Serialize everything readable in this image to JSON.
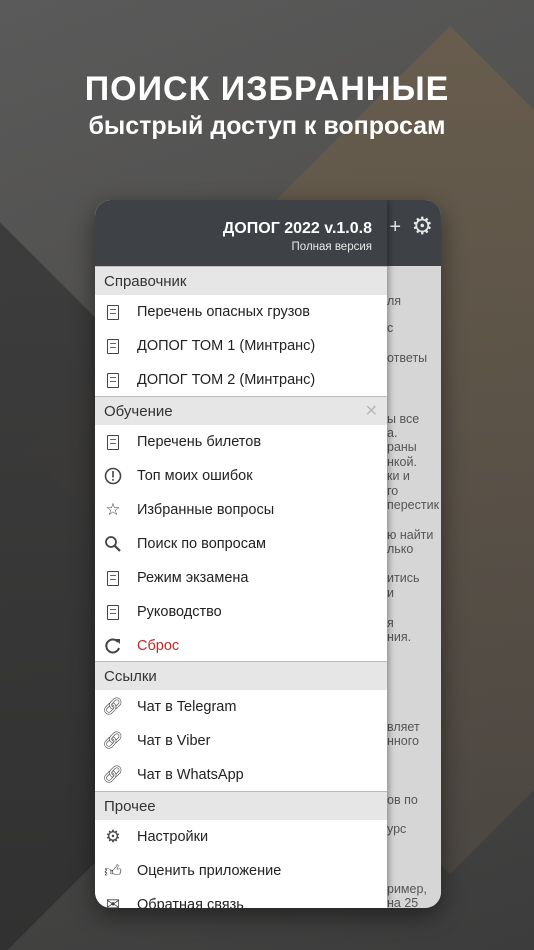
{
  "promo": {
    "title": "ПОИСК ИЗБРАННЫЕ",
    "subtitle": "быстрый доступ к вопросам"
  },
  "drawer": {
    "app_title": "ДОПОГ 2022 v.1.0.8",
    "app_subtitle": "Полная версия",
    "sections": {
      "reference": "Справочник",
      "learning": "Обучение",
      "links": "Ссылки",
      "other": "Прочее"
    },
    "reference_items": [
      "Перечень опасных грузов",
      "ДОПОГ ТОМ 1 (Минтранс)",
      "ДОПОГ ТОМ 2 (Минтранс)"
    ],
    "learning_items": [
      "Перечень билетов",
      "Топ моих ошибок",
      "Избранные вопросы",
      "Поиск по вопросам",
      "Режим экзамена",
      "Руководство",
      "Сброс"
    ],
    "link_items": [
      "Чат в Telegram",
      "Чат в Viber",
      "Чат в WhatsApp"
    ],
    "other_items": [
      "Настройки",
      "Оценить приложение",
      "Обратная связь"
    ]
  },
  "background_text": [
    "ля",
    "с",
    "ответы",
    "ы все",
    "а.",
    "раны",
    "нкой.",
    "ки и",
    "го",
    "перестик",
    "ю найти",
    "лько",
    "итись",
    "и",
    "я",
    "ния.",
    "вляет",
    "нного",
    "ов по",
    "урс",
    "ример,",
    "на 25"
  ],
  "colors": {
    "header": "#3e4246",
    "reset_red": "#c62828"
  }
}
